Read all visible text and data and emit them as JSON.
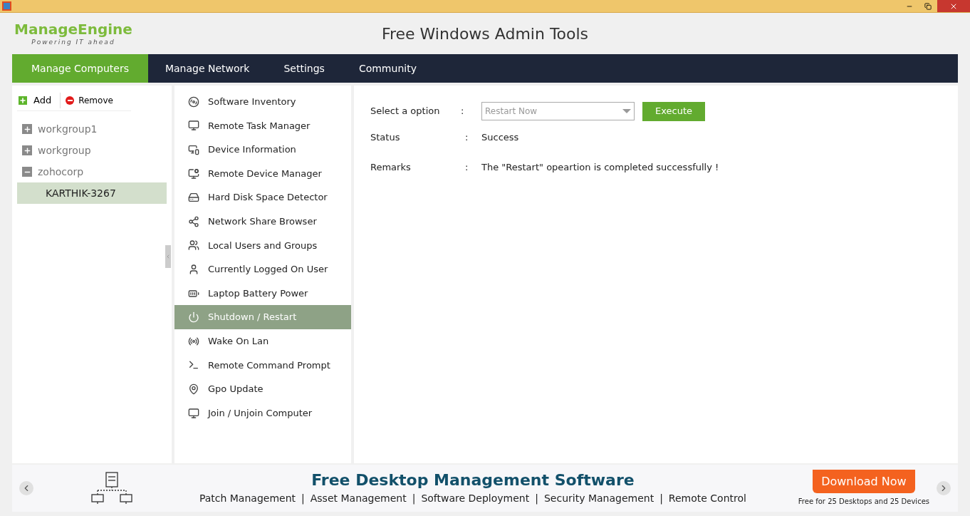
{
  "header": {
    "logo_name": "ManageEngine",
    "logo_tagline": "Powering IT ahead",
    "title": "Free Windows Admin Tools"
  },
  "nav": [
    {
      "label": "Manage Computers",
      "selected": true
    },
    {
      "label": "Manage Network",
      "selected": false
    },
    {
      "label": "Settings",
      "selected": false
    },
    {
      "label": "Community",
      "selected": false
    }
  ],
  "toolbar": {
    "add": "Add",
    "remove": "Remove"
  },
  "tree": [
    {
      "label": "workgroup1",
      "expanded": false
    },
    {
      "label": "workgroup",
      "expanded": false
    },
    {
      "label": "zohocorp",
      "expanded": true,
      "children": [
        {
          "label": "KARTHIK-3267",
          "selected": true
        }
      ]
    }
  ],
  "tools": [
    {
      "label": "Software Inventory",
      "selected": false
    },
    {
      "label": "Remote Task Manager",
      "selected": false
    },
    {
      "label": "Device Information",
      "selected": false
    },
    {
      "label": "Remote Device Manager",
      "selected": false
    },
    {
      "label": "Hard Disk Space Detector",
      "selected": false
    },
    {
      "label": "Network Share Browser",
      "selected": false
    },
    {
      "label": "Local Users and Groups",
      "selected": false
    },
    {
      "label": "Currently Logged On User",
      "selected": false
    },
    {
      "label": "Laptop Battery Power",
      "selected": false
    },
    {
      "label": "Shutdown / Restart",
      "selected": true
    },
    {
      "label": "Wake On Lan",
      "selected": false
    },
    {
      "label": "Remote Command Prompt",
      "selected": false
    },
    {
      "label": "Gpo Update",
      "selected": false
    },
    {
      "label": "Join / Unjoin Computer",
      "selected": false
    }
  ],
  "form": {
    "option_label": "Select a option",
    "option_value": "Restart Now",
    "execute": "Execute",
    "status_label": "Status",
    "status_value": "Success",
    "remarks_label": "Remarks",
    "remarks_value": "The \"Restart\" opeartion is completed successfully !",
    "separator": ":"
  },
  "banner": {
    "title": "Free Desktop Management Software",
    "features": [
      "Patch Management",
      "Asset Management",
      "Software Deployment",
      "Security Management",
      "Remote Control"
    ],
    "separator": "|",
    "cta": "Download Now",
    "cta_note": "Free for 25 Desktops and 25 Devices"
  }
}
